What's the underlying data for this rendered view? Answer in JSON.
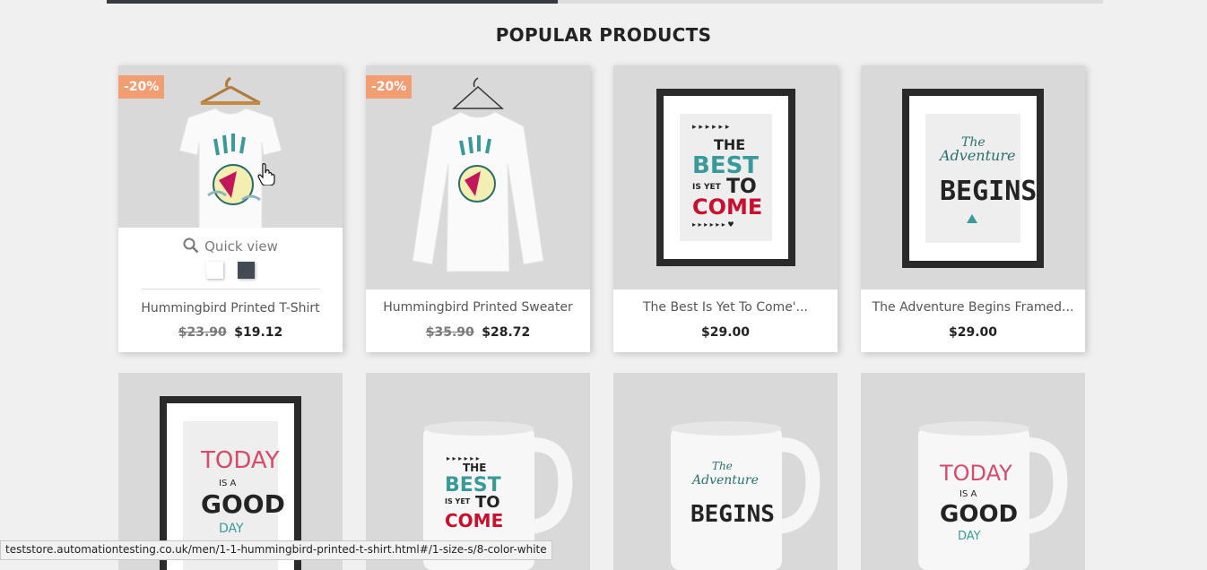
{
  "section": {
    "title": "POPULAR PRODUCTS"
  },
  "products": [
    {
      "name": "Hummingbird Printed T-Shirt",
      "flag": "-20%",
      "old_price": "$23.90",
      "price": "$19.12",
      "quick_view": "Quick view",
      "swatches": [
        "#ffffff",
        "#434a54"
      ]
    },
    {
      "name": "Hummingbird Printed Sweater",
      "flag": "-20%",
      "old_price": "$35.90",
      "price": "$28.72"
    },
    {
      "name": "The Best Is Yet To Come'...",
      "price": "$29.00",
      "art": {
        "line1": "THE",
        "line2": "BEST",
        "line3": "IS YET",
        "line4": "TO",
        "line5": "COME"
      }
    },
    {
      "name": "The Adventure Begins Framed...",
      "price": "$29.00",
      "art": {
        "line1": "The",
        "line2": "Adventure",
        "line3": "BEGINS"
      }
    }
  ],
  "row2": [
    {
      "art": {
        "line1": "TODAY",
        "line2": "IS A",
        "line3": "GOOD",
        "line4": "DAY"
      }
    },
    {
      "art": {
        "line1": "THE",
        "line2": "BEST",
        "line3": "IS YET",
        "line4": "TO",
        "line5": "COME"
      }
    },
    {
      "art": {
        "line1": "The",
        "line2": "Adventure",
        "line3": "BEGINS"
      }
    },
    {
      "art": {
        "line1": "TODAY",
        "line2": "IS A",
        "line3": "GOOD",
        "line4": "DAY"
      }
    }
  ],
  "status": {
    "url": "teststore.automationtesting.co.uk/men/1-1-hummingbird-printed-t-shirt.html#/1-size-s/8-color-white"
  },
  "colors": {
    "flag": "#f39d72",
    "teal": "#3a9a9a",
    "red": "#c8102e",
    "pink": "#d64a6a",
    "dark": "#232323"
  }
}
